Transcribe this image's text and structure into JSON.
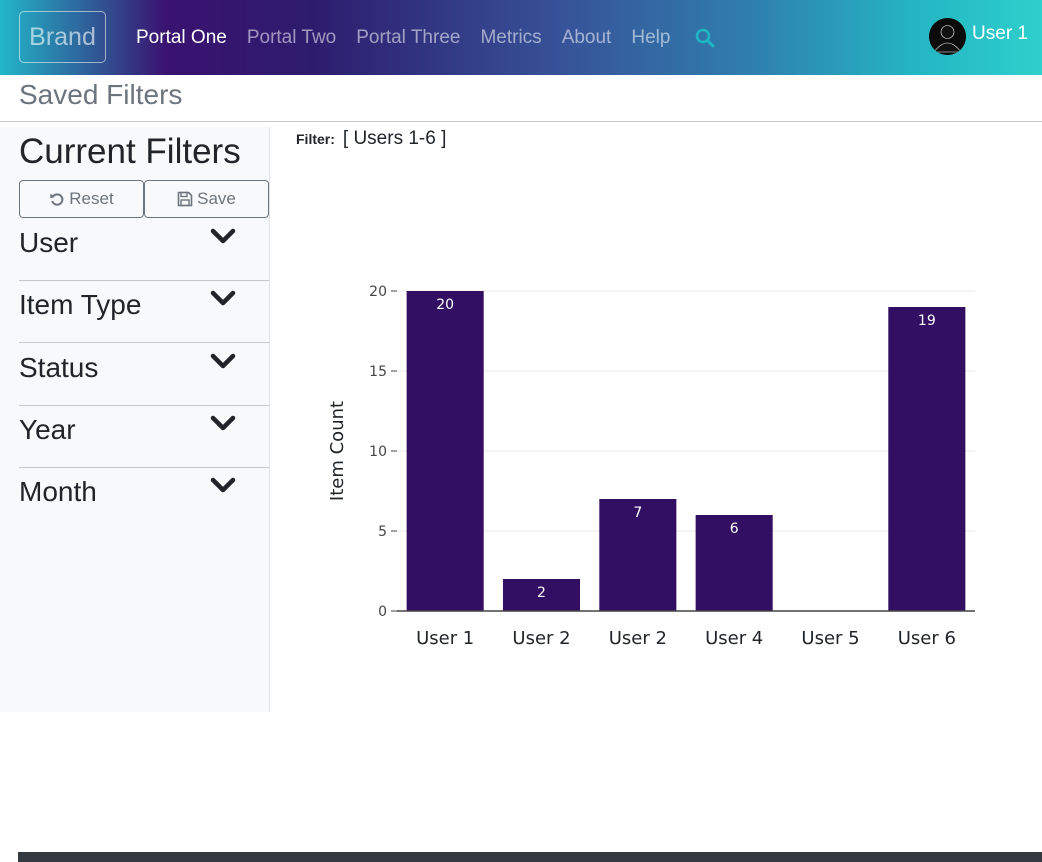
{
  "navbar": {
    "brand": "Brand",
    "links": [
      "Portal One",
      "Portal Two",
      "Portal Three",
      "Metrics",
      "About",
      "Help"
    ],
    "active_index": 0,
    "search_icon": "search-icon",
    "user_name": "User 1",
    "avatar_icon": "user-silhouette-icon"
  },
  "subheader": {
    "title": "Saved Filters"
  },
  "sidebar": {
    "title": "Current Filters",
    "reset_label": "Reset",
    "save_label": "Save",
    "filters": [
      "User",
      "Item Type",
      "Status",
      "Year",
      "Month"
    ]
  },
  "main": {
    "filter_key": "Filter:",
    "filter_value": "[ Users 1-6 ]"
  },
  "chart_data": {
    "type": "bar",
    "categories": [
      "User 1",
      "User 2",
      "User 2",
      "User 4",
      "User 5",
      "User 6"
    ],
    "values": [
      20,
      2,
      7,
      6,
      0,
      19
    ],
    "data_labels": [
      "20",
      "2",
      "7",
      "6",
      "",
      "19"
    ],
    "ylabel": "Item Count",
    "xlabel": "",
    "ylim": [
      0,
      20
    ],
    "yticks": [
      0,
      5,
      10,
      15,
      20
    ],
    "grid": true,
    "bar_color": "#330f63"
  },
  "colors": {
    "accent": "#330f63",
    "search_icon": "#1fb6c6"
  }
}
